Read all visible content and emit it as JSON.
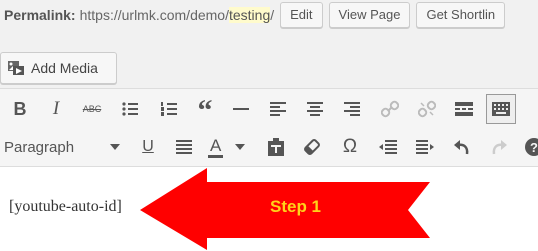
{
  "permalink": {
    "label": "Permalink:",
    "url_prefix": "https://urlmk.com/demo/",
    "slug": "testing",
    "url_suffix": "/",
    "edit_label": "Edit",
    "view_label": "View Page",
    "shortlink_label": "Get Shortlin"
  },
  "media": {
    "add_label": "Add Media"
  },
  "toolbar": {
    "row1": [
      "bold",
      "italic",
      "strikethrough",
      "bulleted-list",
      "numbered-list",
      "blockquote",
      "horizontal-line",
      "align-left",
      "align-center",
      "align-right",
      "insert-link",
      "remove-link",
      "read-more",
      "toolbar-toggle"
    ],
    "row2": [
      "format-select",
      "underline",
      "justify",
      "text-color",
      "paste-as-text",
      "clear-formatting",
      "special-character",
      "outdent",
      "indent",
      "undo",
      "redo",
      "help"
    ],
    "format_value": "Paragraph",
    "bold_glyph": "B",
    "italic_glyph": "I",
    "strike_glyph": "ABC",
    "quote_glyph": "“",
    "underline_glyph": "U",
    "omega_glyph": "Ω",
    "textcolor_glyph": "A",
    "help_glyph": "?"
  },
  "editor": {
    "content": "[youtube-auto-id]"
  },
  "annotation": {
    "text": "Step 1",
    "arrow_color": "#ff0000",
    "text_color": "#ffd21a"
  }
}
